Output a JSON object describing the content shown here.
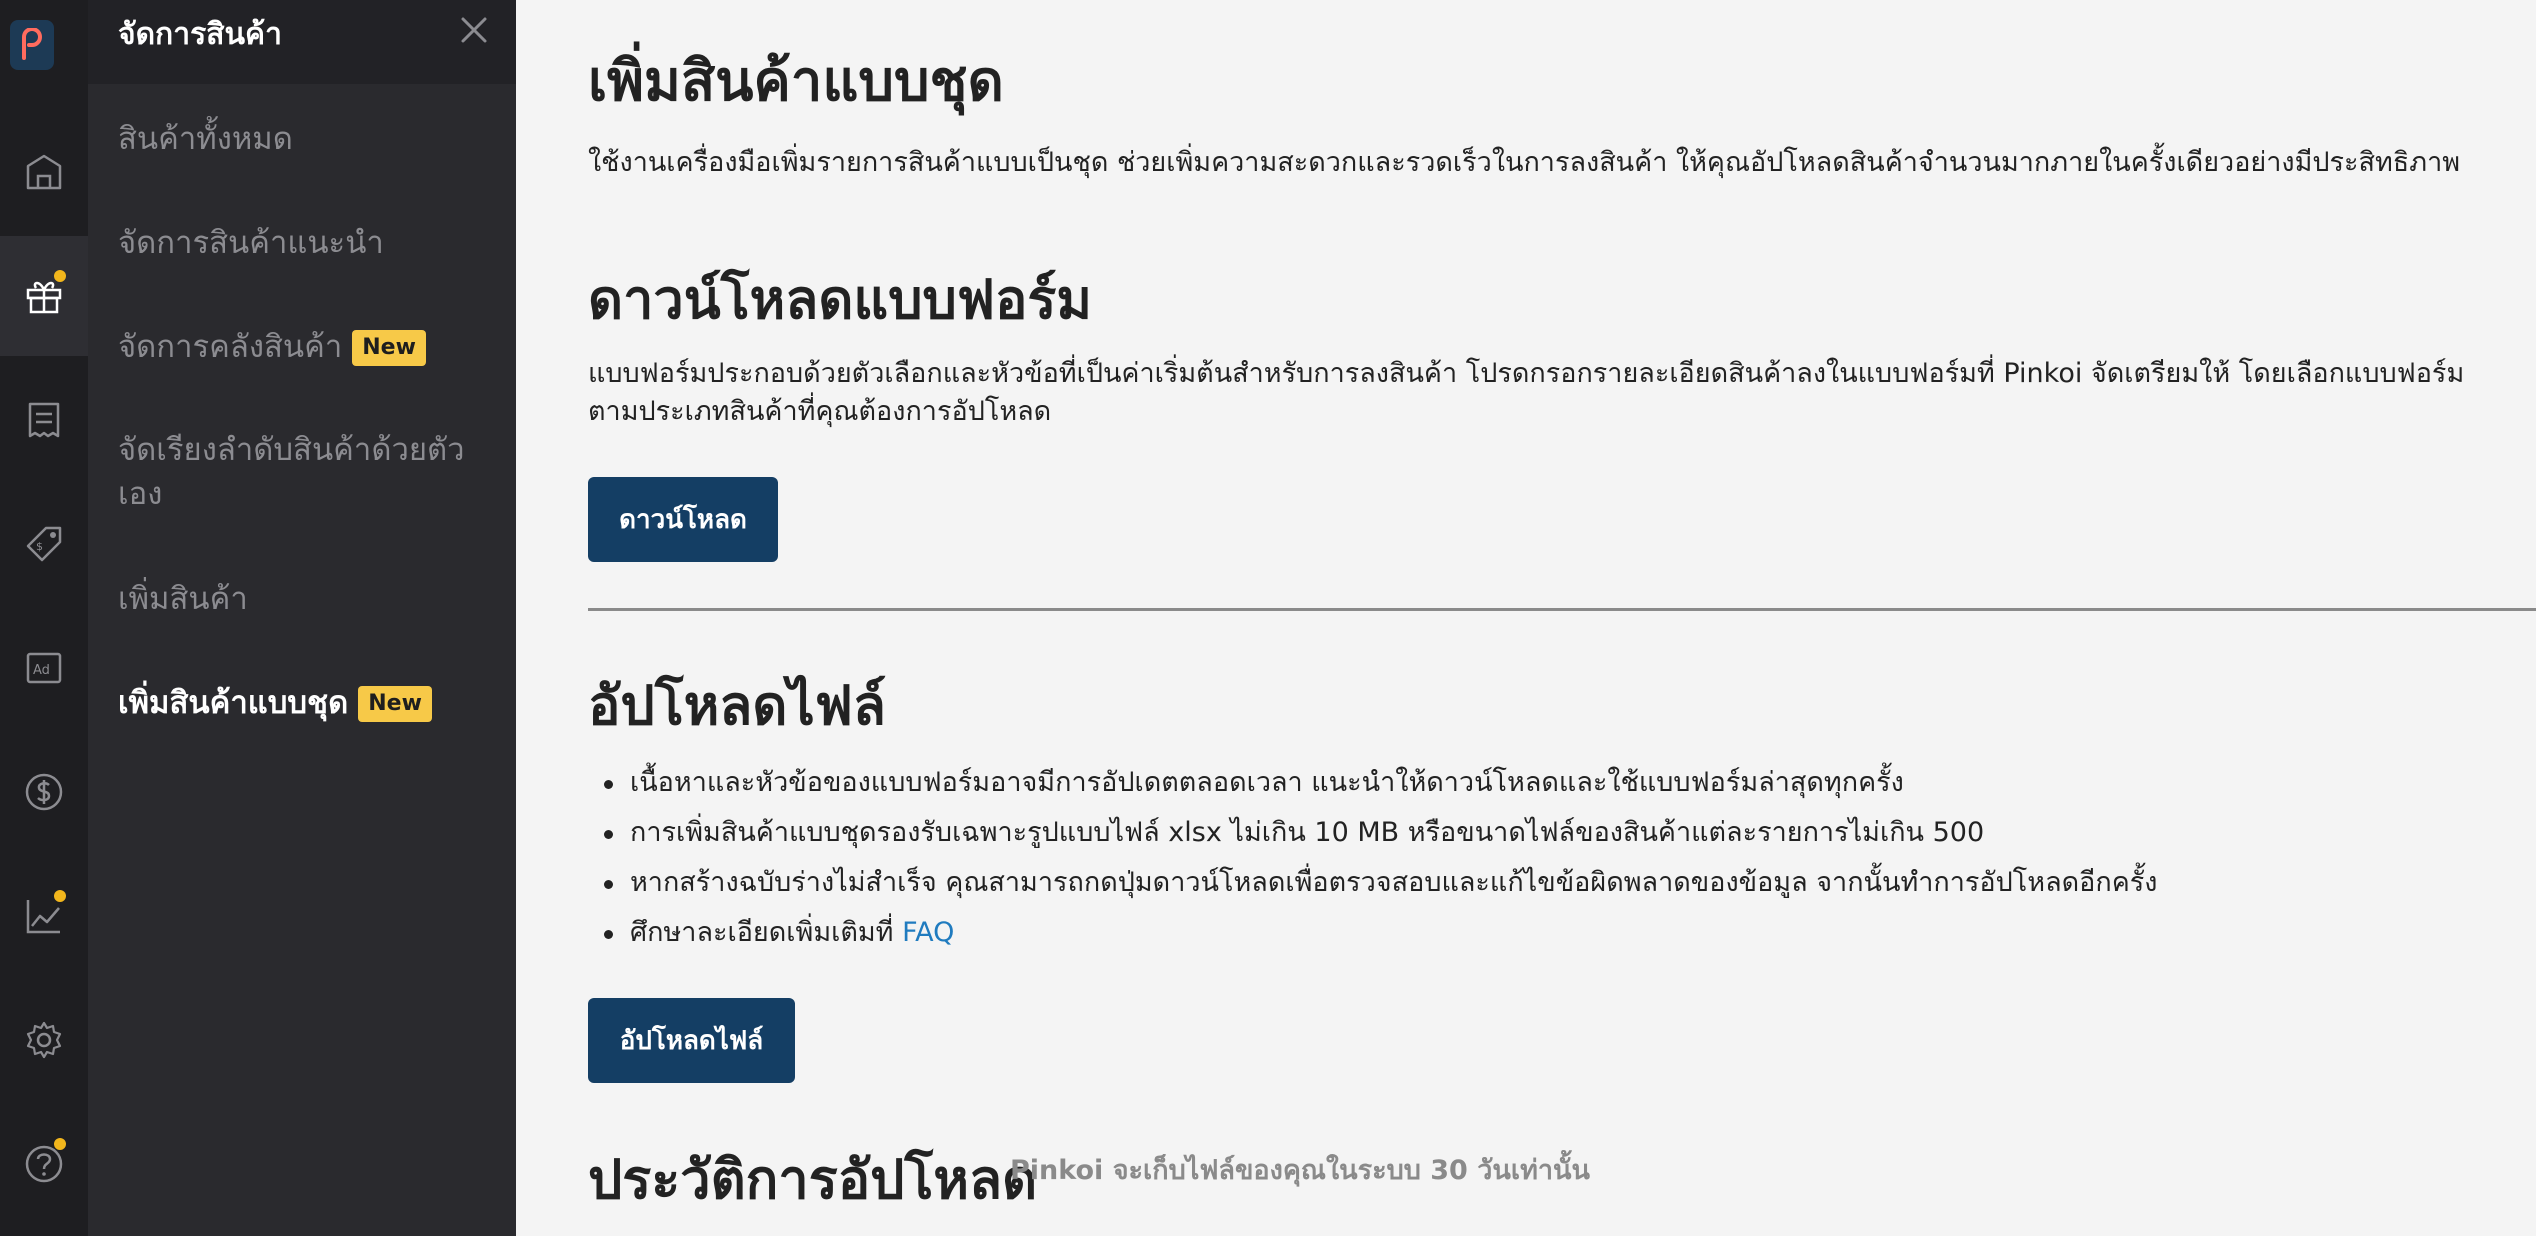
{
  "colors": {
    "rail_bg": "#1e1e21",
    "subnav_bg": "#2a2a2e",
    "accent_button": "#143e64",
    "badge": "#f7c948",
    "notification_dot": "#f2b61c",
    "link": "#1f7bbf"
  },
  "rail": {
    "logo": "pinkoi-logo",
    "items": [
      {
        "icon": "shop-icon"
      },
      {
        "icon": "gift-icon",
        "active": true,
        "has_dot": true
      },
      {
        "icon": "receipt-icon"
      },
      {
        "icon": "price-tag-icon"
      },
      {
        "icon": "ad-icon",
        "text": "Ad"
      },
      {
        "icon": "dollar-icon"
      },
      {
        "icon": "chart-icon",
        "has_dot": true
      },
      {
        "icon": "gear-icon"
      },
      {
        "icon": "help-icon",
        "has_dot": true
      }
    ]
  },
  "subnav": {
    "title": "จัดการสินค้า",
    "items": [
      {
        "label": "สินค้าทั้งหมด"
      },
      {
        "label": "จัดการสินค้าแนะนำ"
      },
      {
        "label": "จัดการคลังสินค้า",
        "badge": "New"
      },
      {
        "label": "จัดเรียงลำดับสินค้าด้วยตัวเอง"
      },
      {
        "label": "เพิ่มสินค้า"
      },
      {
        "label": "เพิ่มสินค้าแบบชุด",
        "badge": "New",
        "active": true
      }
    ]
  },
  "main": {
    "title": "เพิ่มสินค้าแบบชุด",
    "intro": "ใช้งานเครื่องมือเพิ่มรายการสินค้าแบบเป็นชุด ช่วยเพิ่มความสะดวกและรวดเร็วในการลงสินค้า ให้คุณอัปโหลดสินค้าจำนวนมากภายในครั้งเดียวอย่างมีประสิทธิภาพ",
    "download_section": {
      "heading": "ดาวน์โหลดแบบฟอร์ม",
      "description": "แบบฟอร์มประกอบด้วยตัวเลือกและหัวข้อที่เป็นค่าเริ่มต้นสำหรับการลงสินค้า โปรดกรอกรายละเอียดสินค้าลงในแบบฟอร์มที่ Pinkoi จัดเตรียมให้ โดยเลือกแบบฟอร์มตามประเภทสินค้าที่คุณต้องการอัปโหลด",
      "button_label": "ดาวน์โหลด"
    },
    "upload_section": {
      "heading": "อัปโหลดไฟล์",
      "bullets": [
        "เนื้อหาและหัวข้อของแบบฟอร์มอาจมีการอัปเดตตลอดเวลา แนะนำให้ดาวน์โหลดและใช้แบบฟอร์มล่าสุดทุกครั้ง",
        "การเพิ่มสินค้าแบบชุดรองรับเฉพาะรูปแบบไฟล์ xlsx ไม่เกิน 10 MB หรือขนาดไฟล์ของสินค้าแต่ละรายการไม่เกิน 500",
        "หากสร้างฉบับร่างไม่สำเร็จ คุณสามารถกดปุ่มดาวน์โหลดเพื่อตรวจสอบและแก้ไขข้อผิดพลาดของข้อมูล จากนั้นทำการอัปโหลดอีกครั้ง"
      ],
      "faq_prefix": "ศึกษาละเอียดเพิ่มเติมที่ ",
      "faq_link": "FAQ",
      "button_label": "อัปโหลดไฟล์"
    },
    "history_section": {
      "heading": "ประวัติการอัปโหลด",
      "note": "Pinkoi จะเก็บไฟล์ของคุณในระบบ 30 วันเท่านั้น"
    }
  }
}
